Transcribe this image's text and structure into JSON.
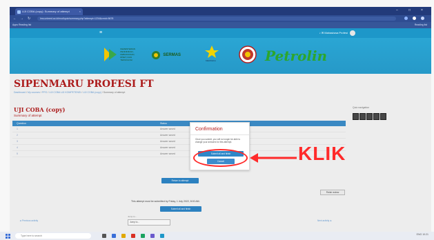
{
  "browser": {
    "tab_title": "UJI COBA (copy): Summary of attempt",
    "tab_close": "×",
    "window_controls": [
      "–",
      "□",
      "×"
    ],
    "url": "lms.unimed.ac.id/mod/quiz/summary.php?attempt=1234&cmid=5678",
    "bookmark": "Apps   Reading list",
    "bookmark_right": "Reading list"
  },
  "site": {
    "menu_icon": "hamburger-menu-icon",
    "user_label": "Mahasiswa Profesi",
    "logos": [
      {
        "name": "kampus-merdeka-logo",
        "text": "KEMENTERIAN PENDIDIKAN, KEBUDAYAAN, RISET, DAN TEKNOLOGI"
      },
      {
        "name": "sermas-logo",
        "text": "SERMAS"
      },
      {
        "name": "merdeka-logo",
        "text": "MERDEKA"
      },
      {
        "name": "university-seal-logo",
        "text": ""
      },
      {
        "name": "petrolin-logo",
        "text": "Petrolin"
      }
    ],
    "petrolin_text": "Petrolin",
    "brand_green": "#2ca62c",
    "header_blue": "#1d97c9"
  },
  "page": {
    "title": "SIPENMARU PROFESI FT",
    "breadcrumb": [
      "Dashboard",
      "My courses",
      "PPG",
      "UJI COBA UJI KOMPETENSI",
      "UJI COBA (copy)",
      "Summary of attempt"
    ]
  },
  "quiz": {
    "title": "UJI COBA (copy)",
    "summary_heading": "Summary of attempt",
    "columns": [
      "Question",
      "Status"
    ],
    "rows": [
      {
        "n": "1",
        "status": "Answer saved"
      },
      {
        "n": "2",
        "status": "Answer saved"
      },
      {
        "n": "3",
        "status": "Answer saved"
      },
      {
        "n": "4",
        "status": "Answer saved"
      },
      {
        "n": "5",
        "status": "Answer saved"
      }
    ],
    "return_button": "Return to attempt",
    "finish_note": "This attempt must be submitted by Friday, 1 July 2022, 8:00 AM.",
    "submit_all_button": "Submit all and finish",
    "finish_review": "Finish review",
    "nav_label": "Quiz navigation",
    "nav_boxes": [
      "1",
      "2",
      "3",
      "4",
      "5"
    ]
  },
  "modal": {
    "title": "Confirmation",
    "message": "Once you submit, you will no longer be able to change your answers for this attempt.",
    "submit_label": "Submit all and finish",
    "cancel_label": "Cancel"
  },
  "footer": {
    "prev_link": "◄ Previous activity",
    "jump_label": "Jump to...",
    "jump_value": "Jump to...",
    "next_link": "Next activity ►"
  },
  "taskbar": {
    "search_placeholder": "Type here to search",
    "tray": "ENG  10:21"
  },
  "annotation": {
    "label": "KLIK",
    "color": "#ff2a2a"
  }
}
